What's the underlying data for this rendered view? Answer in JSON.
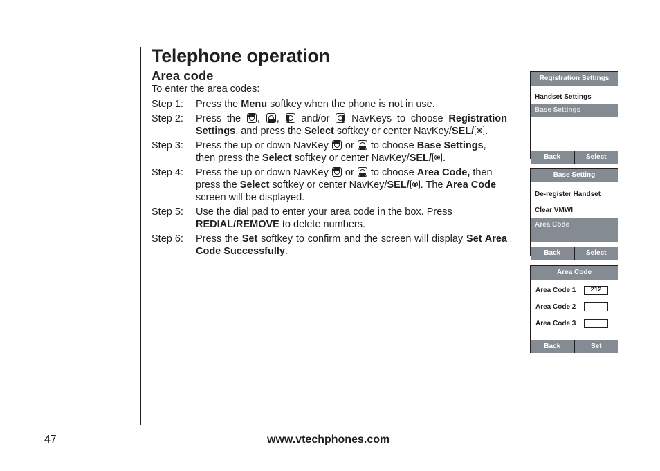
{
  "header": {
    "title": "Telephone operation"
  },
  "section": {
    "title": "Area code",
    "intro": "To enter the area codes:"
  },
  "steps": [
    {
      "label": "Step 1:",
      "parts": [
        "Press the ",
        "Menu",
        " softkey when the phone is not in use."
      ]
    },
    {
      "label": "Step 2:",
      "parts": [
        "Press the",
        "and/or",
        "NavKeys to choose ",
        "Registration Settings",
        ", and press the ",
        "Select",
        " softkey or center NavKey/",
        "SEL",
        "/",
        "."
      ]
    },
    {
      "label": "Step 3:",
      "parts": [
        "Press the up or down NavKey ",
        " or ",
        " to choose ",
        "Base Settings",
        ", then press the ",
        "Select",
        " softkey or center NavKey/",
        "SEL",
        "/",
        "."
      ]
    },
    {
      "label": "Step 4:",
      "parts": [
        "Press the up or down NavKey ",
        " or ",
        " to choose ",
        "Area Code,",
        " then press the ",
        "Select",
        " softkey or center NavKey/",
        "SEL",
        "/",
        ". The ",
        "Area Code",
        " screen will be displayed."
      ]
    },
    {
      "label": "Step 5:",
      "parts": [
        "Use the dial pad to enter your area code in the box. Press ",
        "REDIAL",
        "/",
        "REMOVE",
        " to delete numbers."
      ]
    },
    {
      "label": "Step 6:",
      "parts": [
        "Press the ",
        "Set",
        " softkey to confirm and the screen will display ",
        "Set Area Code Successfully",
        "."
      ]
    }
  ],
  "icons": {
    "up": "navkey-up-icon",
    "down": "navkey-down-icon",
    "left": "navkey-left-icon",
    "right": "navkey-right-icon",
    "center": "navkey-center-sel-icon"
  },
  "screens": [
    {
      "header": "Registration Settings",
      "items": [
        {
          "label": "Handset Settings",
          "selected": false
        },
        {
          "label": "Base Settings",
          "selected": true
        }
      ],
      "softkeys": [
        "Back",
        "Select"
      ]
    },
    {
      "header": "Base Setting",
      "items": [
        {
          "label": "De-register Handset",
          "selected": false
        },
        {
          "label": "Clear VMWI",
          "selected": false
        },
        {
          "label": "Area Code",
          "selected": true
        }
      ],
      "softkeys": [
        "Back",
        "Select"
      ]
    },
    {
      "header": "Area Code",
      "fields": [
        {
          "label": "Area Code 1",
          "value": "212"
        },
        {
          "label": "Area Code 2",
          "value": ""
        },
        {
          "label": "Area Code 3",
          "value": ""
        }
      ],
      "softkeys": [
        "Back",
        "Set"
      ]
    }
  ],
  "colors": {
    "highlight": "#858b93",
    "text": "#231f20"
  },
  "footer": {
    "page_number": "47",
    "website": "www.vtechphones.com"
  }
}
